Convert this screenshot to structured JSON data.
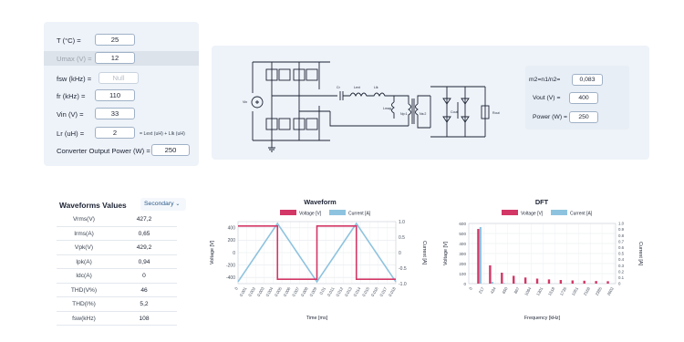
{
  "inputs": {
    "temperature": {
      "label": "T (°C) =",
      "value": "25"
    },
    "umax": {
      "label": "Umax (V) =",
      "value": "12"
    },
    "fsw": {
      "label": "fsw (kHz) =",
      "value": "Null"
    },
    "fr": {
      "label": "fr (kHz) =",
      "value": "110"
    },
    "vin": {
      "label": "Vin (V) =",
      "value": "33"
    },
    "lr": {
      "label": "Lr (uH) =",
      "value": "2",
      "note": "= Lext (uH) + Llk (uH)"
    },
    "output_power": {
      "label": "Converter Output Power (W) =",
      "value": "250"
    }
  },
  "outputs": {
    "ratio": {
      "label": "m2=n1/n2=",
      "value": "0,083"
    },
    "vout": {
      "label": "Vout (V) =",
      "value": "400"
    },
    "power": {
      "label": "Power (W) =",
      "value": "250"
    }
  },
  "schematic": {
    "labels": {
      "vin": "Vin",
      "cr": "Cr",
      "lext": "Lext",
      "llk": "Llk",
      "lm": "Lmag",
      "np": "Np:1",
      "ns": "Ns:2",
      "cout": "Cout",
      "rout": "Rout"
    }
  },
  "waveforms_values": {
    "title": "Waveforms Values",
    "dropdown": "Secondary",
    "rows": [
      {
        "name": "Vrms(V)",
        "value": "427,2"
      },
      {
        "name": "Irms(A)",
        "value": "0,65"
      },
      {
        "name": "Vpk(V)",
        "value": "429,2"
      },
      {
        "name": "Ipk(A)",
        "value": "0,94"
      },
      {
        "name": "Idc(A)",
        "value": "0"
      },
      {
        "name": "THD(V%)",
        "value": "46"
      },
      {
        "name": "THD(I%)",
        "value": "5,2"
      },
      {
        "name": "fsw(kHz)",
        "value": "108"
      }
    ]
  },
  "chart_data": [
    {
      "type": "line",
      "title": "Waveform",
      "xlabel": "Time [ms]",
      "ylabel": "Voltage [V]",
      "y2label": "Current [A]",
      "ylim": [
        -500,
        500
      ],
      "y2lim": [
        -1.0,
        1.0
      ],
      "x_ticks": [
        "0",
        "0.001",
        "0.002",
        "0.003",
        "0.004",
        "0.005",
        "0.006",
        "0.007",
        "0.008",
        "0.009",
        "0.01",
        "0.011",
        "0.012",
        "0.013",
        "0.014",
        "0.015",
        "0.016",
        "0.017",
        "0.018"
      ],
      "y_ticks": [
        400,
        200,
        0,
        -200,
        -400
      ],
      "y2_ticks": [
        "1.0",
        "0.5",
        "0",
        "-0.5",
        "-1.0"
      ],
      "series": [
        {
          "name": "Voltage [V]",
          "color": "#d33766",
          "x": [
            0,
            0.0045,
            0.0045,
            0.009,
            0.009,
            0.0135,
            0.0135,
            0.018
          ],
          "y": [
            429,
            429,
            -429,
            -429,
            429,
            429,
            -429,
            -429
          ]
        },
        {
          "name": "Current [A]",
          "color": "#8ec3df",
          "x": [
            0,
            0.0045,
            0.009,
            0.0135,
            0.018
          ],
          "y": [
            -0.94,
            0.94,
            -0.94,
            0.94,
            -0.94
          ]
        }
      ],
      "legend": "top"
    },
    {
      "type": "bar",
      "title": "DFT",
      "xlabel": "Frequency [kHz]",
      "ylabel": "Voltage [V]",
      "y2label": "Current [A]",
      "ylim": [
        0,
        600
      ],
      "y2lim": [
        0,
        1.0
      ],
      "categories": [
        "0",
        "217",
        "434",
        "650",
        "867",
        "1084",
        "1301",
        "1518",
        "1735",
        "1951",
        "2168",
        "2385",
        "2602"
      ],
      "y_ticks": [
        600,
        500,
        400,
        300,
        200,
        100,
        0
      ],
      "y2_ticks": [
        "1.0",
        "0.9",
        "0.8",
        "0.7",
        "0.6",
        "0.5",
        "0.4",
        "0.3",
        "0.2",
        "0.1",
        "0"
      ],
      "series": [
        {
          "name": "Voltage [V]",
          "color": "#d33766",
          "values": [
            0,
            545,
            0,
            182,
            0,
            109,
            0,
            78,
            0,
            61,
            0,
            50,
            0,
            42,
            0,
            36,
            0,
            32,
            0,
            29,
            0,
            26,
            0,
            24,
            0
          ]
        },
        {
          "name": "Current [A]",
          "color": "#8ec3df",
          "values": [
            0,
            0.94,
            0,
            0.03,
            0,
            0.01,
            0,
            0.005,
            0,
            0.003,
            0,
            0.002,
            0,
            0.001,
            0,
            0,
            0,
            0,
            0,
            0,
            0,
            0,
            0,
            0,
            0
          ]
        }
      ],
      "legend": "top"
    }
  ]
}
